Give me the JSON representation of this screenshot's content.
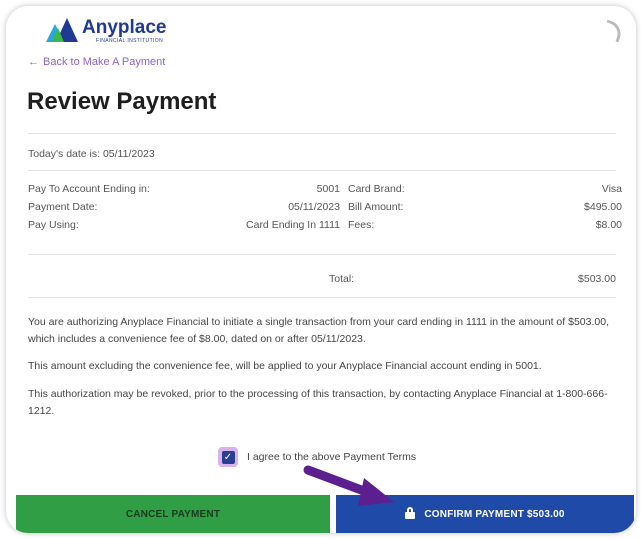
{
  "brand": {
    "name": "Anyplace",
    "sub": "FINANCIAL INSTITUTION",
    "colors": {
      "primary": "#1f3a93",
      "accent_purple": "#8a63c9",
      "green": "#2f9e45",
      "blue": "#1f4aa8"
    }
  },
  "nav": {
    "back_label": "Back to Make A Payment",
    "back_icon": "arrow-left-icon"
  },
  "page": {
    "title": "Review Payment"
  },
  "today": "Today's date is: 05/11/2023",
  "details": {
    "rows": [
      {
        "label1": "Pay To Account Ending in:",
        "value1": "5001",
        "label2": "Card Brand:",
        "value2": "Visa"
      },
      {
        "label1": "Payment Date:",
        "value1": "05/11/2023",
        "label2": "Bill Amount:",
        "value2": "$495.00"
      },
      {
        "label1": "Pay Using:",
        "value1": "Card Ending In 1111",
        "label2": "Fees:",
        "value2": "$8.00"
      }
    ],
    "total_label": "Total:",
    "total_value": "$503.00"
  },
  "terms": {
    "p1": "You are authorizing Anyplace Financial to initiate a single transaction from your card ending in 1111 in the amount of $503.00, which includes a convenience fee of $8.00, dated on or after 05/11/2023.",
    "p2": "This amount excluding the convenience fee, will be applied to your Anyplace Financial account ending in 5001.",
    "p3": "This authorization may be revoked, prior to the processing of this transaction, by contacting Anyplace Financial at 1-800-666-1212.",
    "agree_label": "I agree to the above Payment Terms",
    "agree_checked": true
  },
  "buttons": {
    "cancel": "CANCEL PAYMENT",
    "confirm": "CONFIRM PAYMENT $503.00",
    "confirm_icon": "lock-icon"
  }
}
